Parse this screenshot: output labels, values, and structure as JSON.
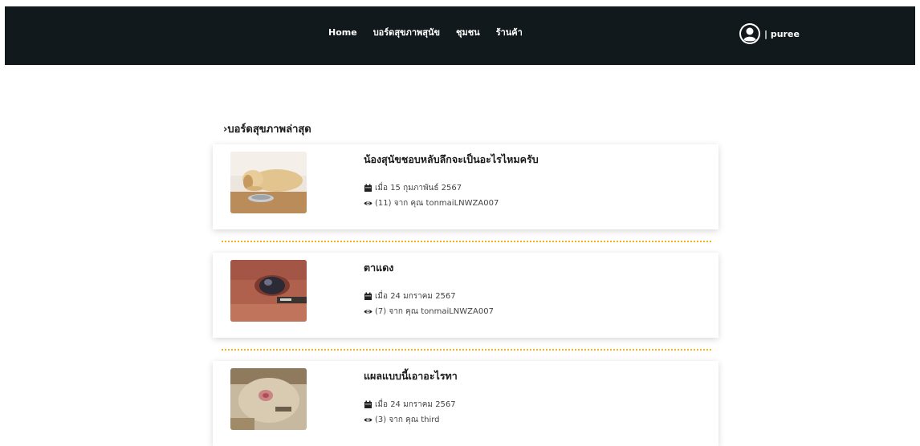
{
  "nav": {
    "links": [
      "Home",
      "บอร์ดสุขภาพสุนัข",
      "ชุมชน",
      "ร้านค้า"
    ],
    "username": "| puree"
  },
  "section": {
    "title": "›บอร์ดสุขภาพล่าสุด"
  },
  "posts": [
    {
      "title": "น้องสุนัขชอบหลับลึกจะเป็นอะไรไหมครับ",
      "date": "เมื่อ 15 กุมภาพันธ์ 2567",
      "views": "(11) จาก คุณ tonmaiLNWZA007",
      "image": "sleeping-dog-photo"
    },
    {
      "title": "ตาแดง",
      "date": "เมื่อ 24 มกราคม 2567",
      "views": "(7) จาก คุณ tonmaiLNWZA007",
      "image": "red-eye-photo"
    },
    {
      "title": "แผลแบบนี้เอาอะไรทา",
      "date": "เมื่อ 24 มกราคม 2567",
      "views": "(3) จาก คุณ third",
      "image": "wound-skin-photo"
    }
  ],
  "colors": {
    "navbar": "#11191c",
    "divider": "#f2b51e"
  }
}
